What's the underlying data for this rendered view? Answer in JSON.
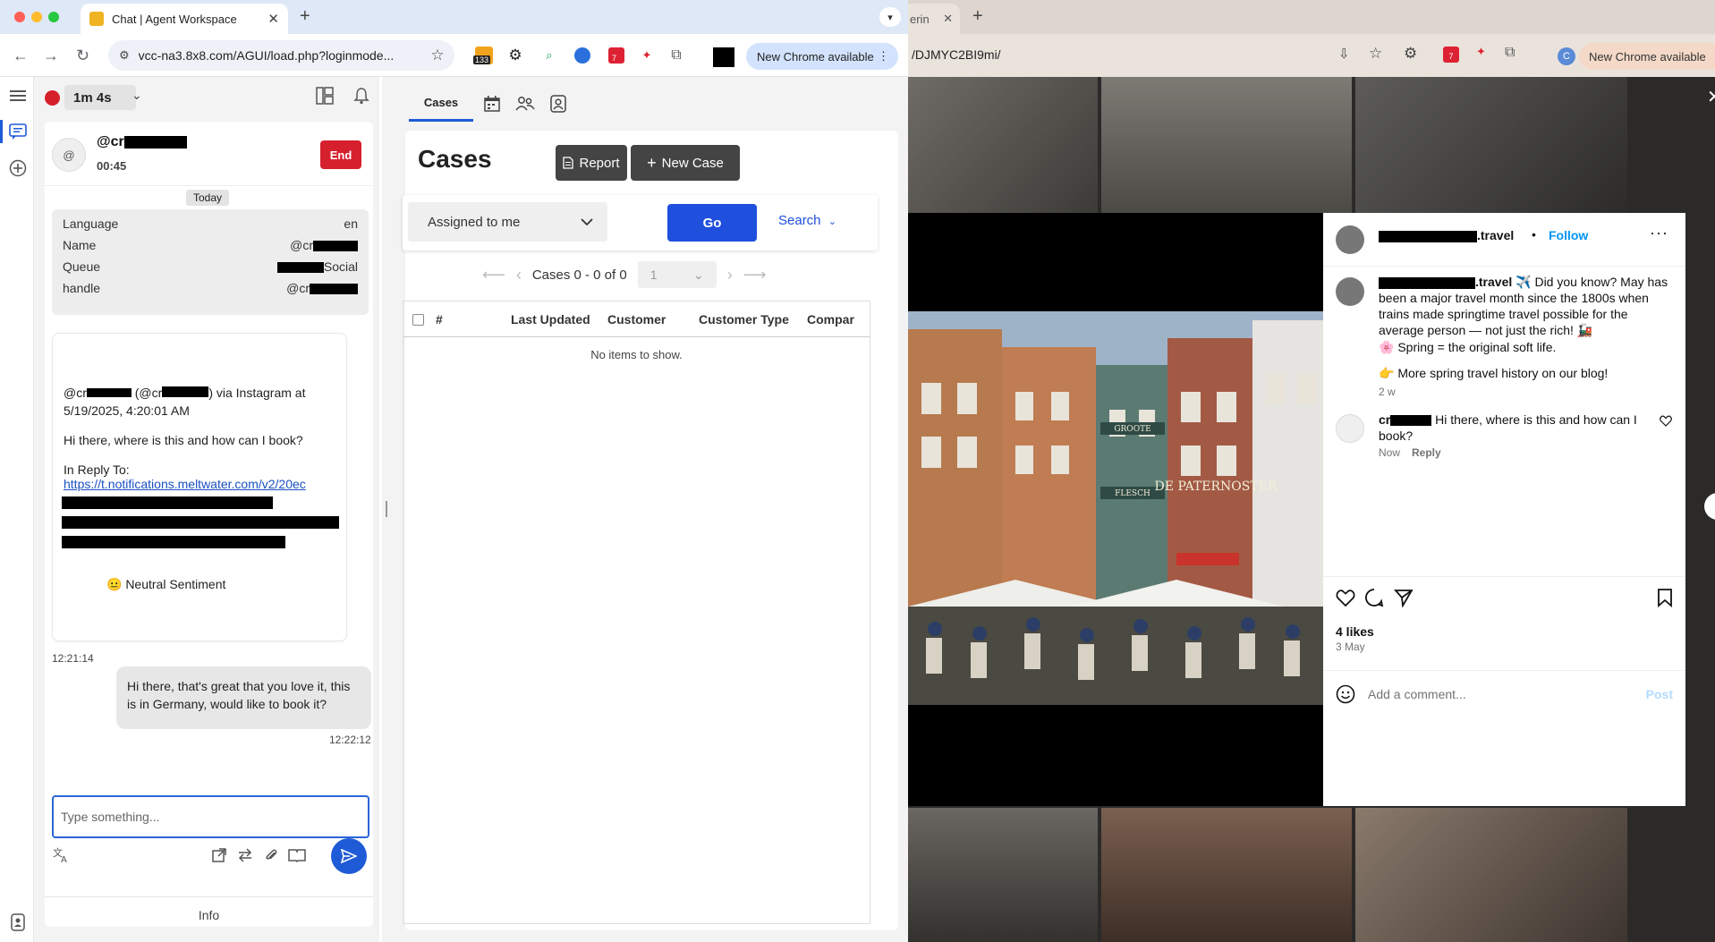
{
  "left_window": {
    "tab": {
      "title": "Chat | Agent Workspace"
    },
    "url": "vcc-na3.8x8.com/AGUI/load.php?loginmode...",
    "extension_badges": {
      "count": "133",
      "alert": "7"
    },
    "chrome_available": "New Chrome available"
  },
  "session": {
    "timer": "1m 4s"
  },
  "contact": {
    "avatar_text": "@",
    "handle": "@cr",
    "elapsed": "00:45",
    "end_label": "End"
  },
  "chat": {
    "date_chip": "Today",
    "info_rows": [
      {
        "label": "Language",
        "value": "en"
      },
      {
        "label": "Name",
        "value": "@cr"
      },
      {
        "label": "Queue",
        "value": "Social"
      },
      {
        "label": "handle",
        "value": "@cr"
      }
    ],
    "incoming": {
      "line1": "@cr",
      "line1_mid": "(@cr",
      "line1_end": ") via Instagram at",
      "line2": "5/19/2025, 4:20:01 AM",
      "body": "Hi there, where is this and how can I book?",
      "reply_label": "In Reply To:",
      "link": "https://t.notifications.meltwater.com/v2/20ec",
      "sentiment": "😐 Neutral Sentiment",
      "time": "12:21:14"
    },
    "outgoing": {
      "body": "Hi there, that's great that you love it, this is in Germany, would like to book it?",
      "time": "12:22:12"
    },
    "composer_placeholder": "Type something...",
    "info_tab": "Info"
  },
  "cases": {
    "tab_label": "Cases",
    "title": "Cases",
    "report_label": "Report",
    "new_case_label": "New Case",
    "filter_value": "Assigned to me",
    "go_label": "Go",
    "search_label": "Search",
    "pager_text": "Cases 0 - 0 of 0",
    "page_value": "1",
    "columns": [
      "#",
      "Last Updated",
      "Customer",
      "Customer Type",
      "Compar"
    ],
    "empty_text": "No items to show."
  },
  "right_window": {
    "tab_fragment": "erin",
    "url_fragment": "/DJMYC2BI9mi/",
    "chrome_available": "New Chrome available",
    "extension_avatar": "C",
    "extension_alert": "7"
  },
  "instagram": {
    "account_suffix": ".travel",
    "follow_label": "Follow",
    "caption_suffix": ".travel",
    "caption": "✈️ Did you know? May has been a major travel month since the 1800s when trains made springtime travel possible for the average person — not just the rich! 🚂",
    "caption_line2": "🌸 Spring = the original soft life.",
    "caption_line3": "👉 More spring travel history on our blog!",
    "caption_age": "2 w",
    "comment_user": "cr",
    "comment_text": "Hi there, where is this and how can I book?",
    "comment_age": "Now",
    "comment_reply": "Reply",
    "likes": "4 likes",
    "date": "3 May",
    "add_comment_placeholder": "Add a comment...",
    "post_label": "Post"
  },
  "photo_signs": {
    "sign1": "DE PATERNOSTER",
    "sign2": "GROOTE",
    "sign3": "FLESCH"
  }
}
